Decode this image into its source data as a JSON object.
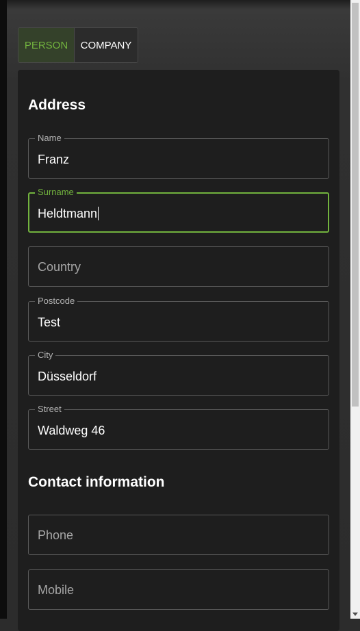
{
  "tabs": {
    "person_label": "PERSON",
    "company_label": "COMPANY",
    "active": "person"
  },
  "address": {
    "title": "Address",
    "name": {
      "label": "Name",
      "value": "Franz"
    },
    "surname": {
      "label": "Surname",
      "value": "Heldtmann"
    },
    "country": {
      "placeholder": "Country"
    },
    "postcode": {
      "label": "Postcode",
      "value": "Test"
    },
    "city": {
      "label": "City",
      "value": "Düsseldorf"
    },
    "street": {
      "label": "Street",
      "value": "Waldweg 46"
    }
  },
  "contact": {
    "title": "Contact information",
    "phone": {
      "placeholder": "Phone"
    },
    "mobile": {
      "placeholder": "Mobile"
    }
  },
  "colors": {
    "accent": "#72b33e",
    "card_background": "#1e1e1e",
    "page_background": "#2c2c2c",
    "border": "#5a5a5a"
  }
}
